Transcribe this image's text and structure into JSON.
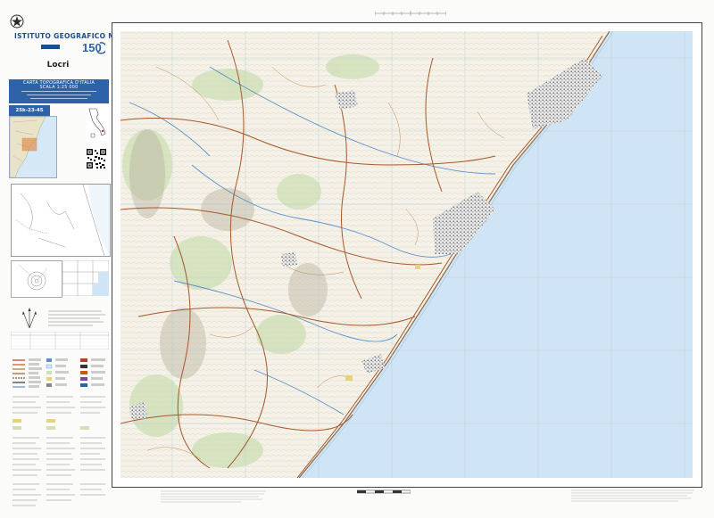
{
  "header": {
    "agency": "Istituto Geografico Militare",
    "badge": "150"
  },
  "sheet": {
    "name": "Locri",
    "code": "25k-23-45"
  },
  "title_box": {
    "line1": "CARTA TOPOGRAFICA D'ITALIA",
    "line2": "SCALA 1:25 000"
  },
  "colors": {
    "sea": "#cfe4f5",
    "land": "#f4f2e8",
    "roads": "#a8562a",
    "rivers": "#5b8fc9",
    "urban": "#7a7a7a",
    "vegetation": "#cfe0b8",
    "title_blue": "#2d62a8"
  },
  "icons": {
    "emblem": "italian-republic-emblem-icon",
    "north": "north-arrow-icon",
    "qr": "qr-code-icon"
  }
}
